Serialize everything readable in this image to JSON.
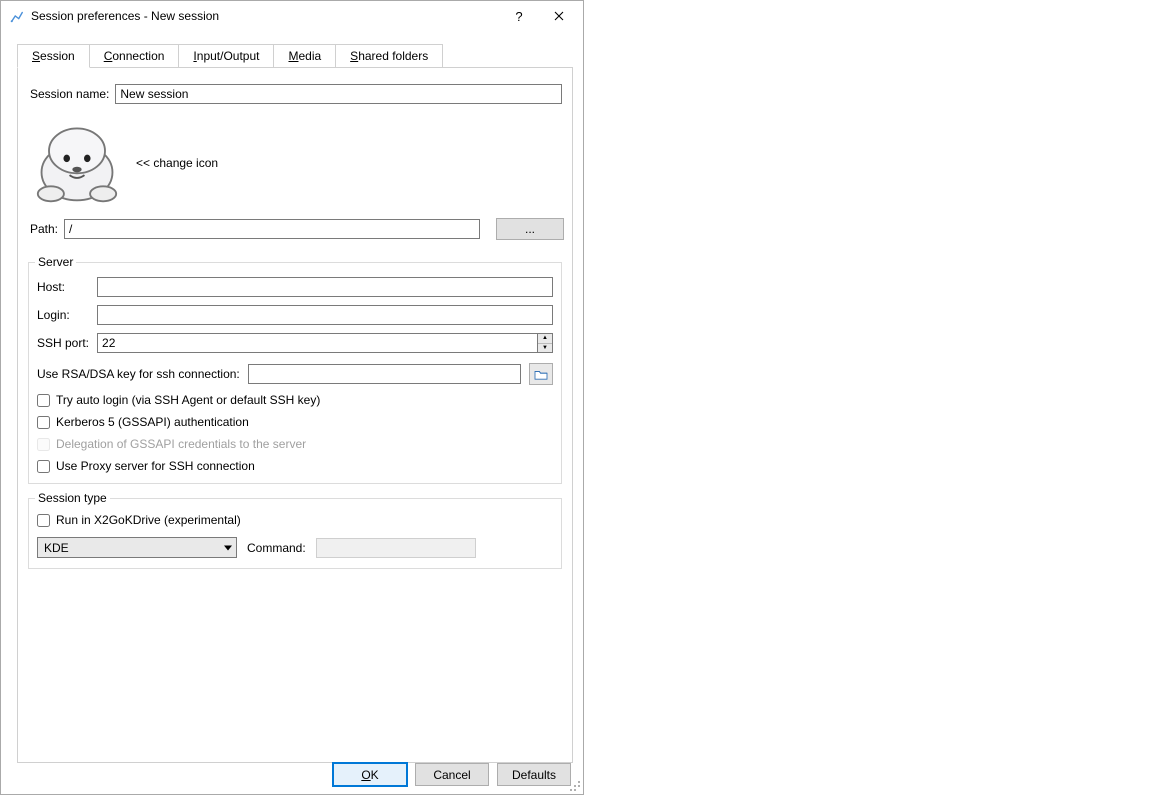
{
  "window": {
    "title": "Session preferences - New session",
    "help_tooltip": "?",
    "close_tooltip": "Close"
  },
  "tabs": [
    "Session",
    "Connection",
    "Input/Output",
    "Media",
    "Shared folders"
  ],
  "tabs_mnemonic_index": [
    0,
    0,
    0,
    0,
    0
  ],
  "active_tab": 0,
  "session_name": {
    "label": "Session name:",
    "value": "New session"
  },
  "change_icon_text": "<< change icon",
  "path": {
    "label": "Path:",
    "value": "/",
    "browse_label": "..."
  },
  "server_group": {
    "legend": "Server",
    "host_label": "Host:",
    "host_value": "",
    "login_label": "Login:",
    "login_value": "",
    "ssh_port_label": "SSH port:",
    "ssh_port_value": "22",
    "rsa_label": "Use RSA/DSA key for ssh connection:",
    "rsa_value": "",
    "auto_login_label": "Try auto login (via SSH Agent or default SSH key)",
    "kerberos_label": "Kerberos 5 (GSSAPI) authentication",
    "delegation_label": "Delegation of GSSAPI credentials to the server",
    "proxy_label": "Use Proxy server for SSH connection",
    "auto_login_checked": false,
    "kerberos_checked": false,
    "delegation_checked": false,
    "delegation_enabled": false,
    "proxy_checked": false
  },
  "session_type_group": {
    "legend": "Session type",
    "kdrive_label": "Run in X2GoKDrive (experimental)",
    "kdrive_checked": false,
    "selected_type": "KDE",
    "command_label": "Command:",
    "command_value": "",
    "command_enabled": false
  },
  "buttons": {
    "ok": "OK",
    "cancel": "Cancel",
    "defaults": "Defaults"
  }
}
